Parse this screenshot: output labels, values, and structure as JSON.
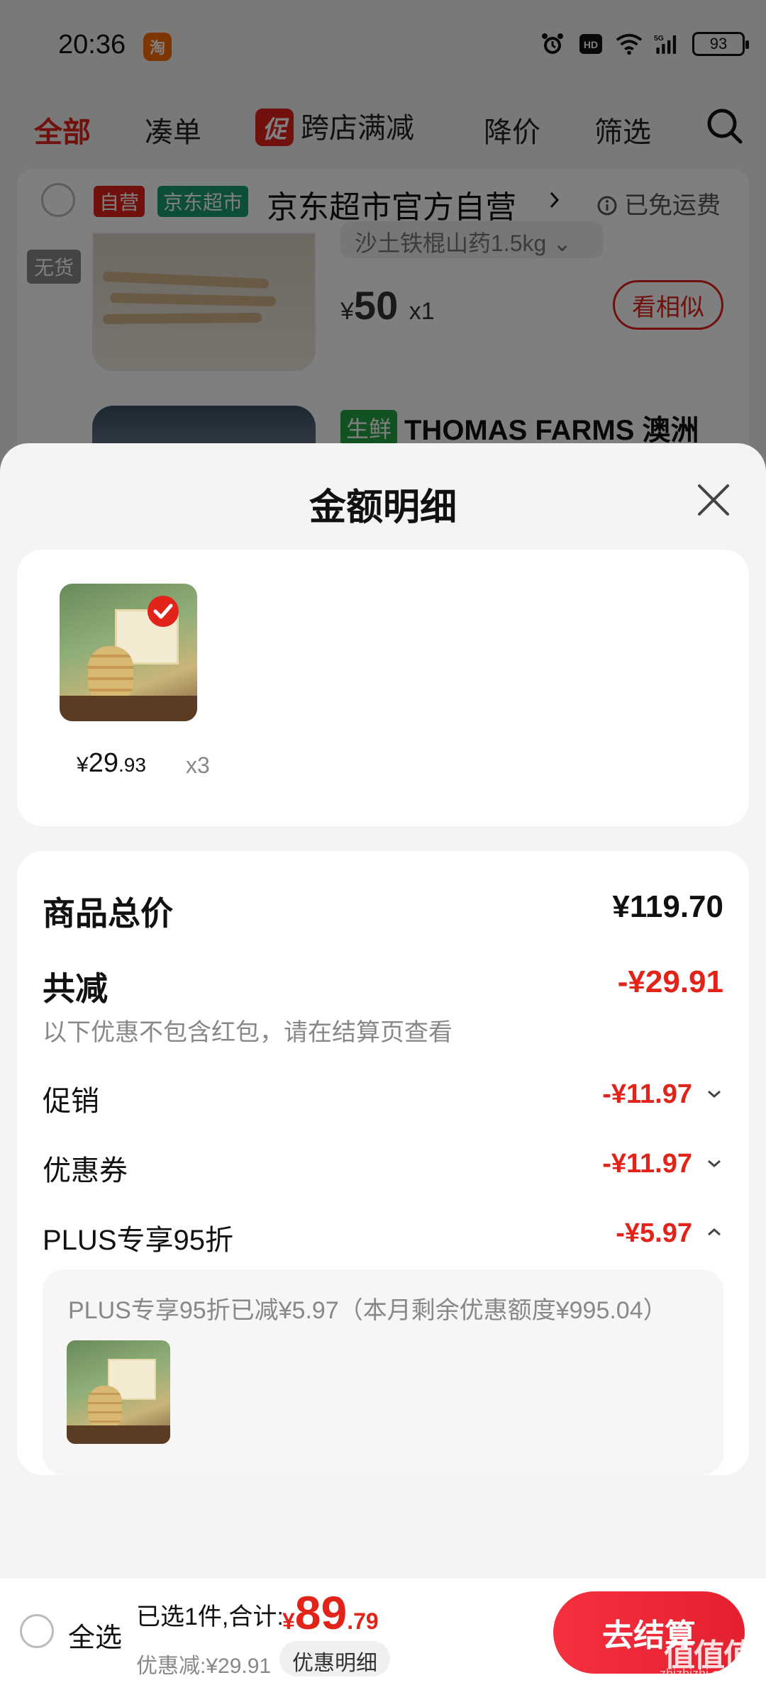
{
  "status_bar": {
    "time": "20:36",
    "app_icon": "淘",
    "battery": "93"
  },
  "top_nav": {
    "all": "全部",
    "combine": "凑单",
    "promo_badge": "促",
    "cross_store": "跨店满减",
    "price_drop": "降价",
    "filter": "筛选"
  },
  "store": {
    "tag_self": "自营",
    "tag_market": "京东超市",
    "name": "京东超市官方自营",
    "free_shipping": "已免运费"
  },
  "background_items": {
    "no_stock": "无货",
    "spec": "沙土铁棍山药1.5kg",
    "price_symbol": "¥",
    "price": "50",
    "qty": "x1",
    "similar_button": "看相似",
    "fresh_tag": "生鲜",
    "title2": "THOMAS FARMS 澳洲"
  },
  "sheet": {
    "title": "金额明细",
    "product": {
      "price_symbol": "¥",
      "price_int": "29",
      "price_dec": ".93",
      "qty": "x3"
    },
    "rows": {
      "total_label": "商品总价",
      "total_value": "¥119.70",
      "reduce_label": "共减",
      "reduce_value": "-¥29.91",
      "reduce_note": "以下优惠不包含红包，请在结算页查看",
      "promo_label": "促销",
      "promo_value": "-¥11.97",
      "coupon_label": "优惠券",
      "coupon_value": "-¥11.97",
      "plus_label": "PLUS专享95折",
      "plus_value": "-¥5.97"
    },
    "plus_note": "PLUS专享95折已减¥5.97（本月剩余优惠额度¥995.04）"
  },
  "bottom_bar": {
    "select_all": "全选",
    "summary": "已选1件,合计:",
    "total_symbol": "¥",
    "total_int": "89",
    "total_dec": ".79",
    "discount": "优惠减:¥29.91",
    "detail_button": "优惠明细",
    "checkout_button": "去结算"
  },
  "watermark": {
    "main": "值值值",
    "sub": "zhizhizhi.com"
  },
  "colors": {
    "accent_red": "#e2231a",
    "fresh_green": "#25a244",
    "market_green": "#1b9c6c"
  }
}
